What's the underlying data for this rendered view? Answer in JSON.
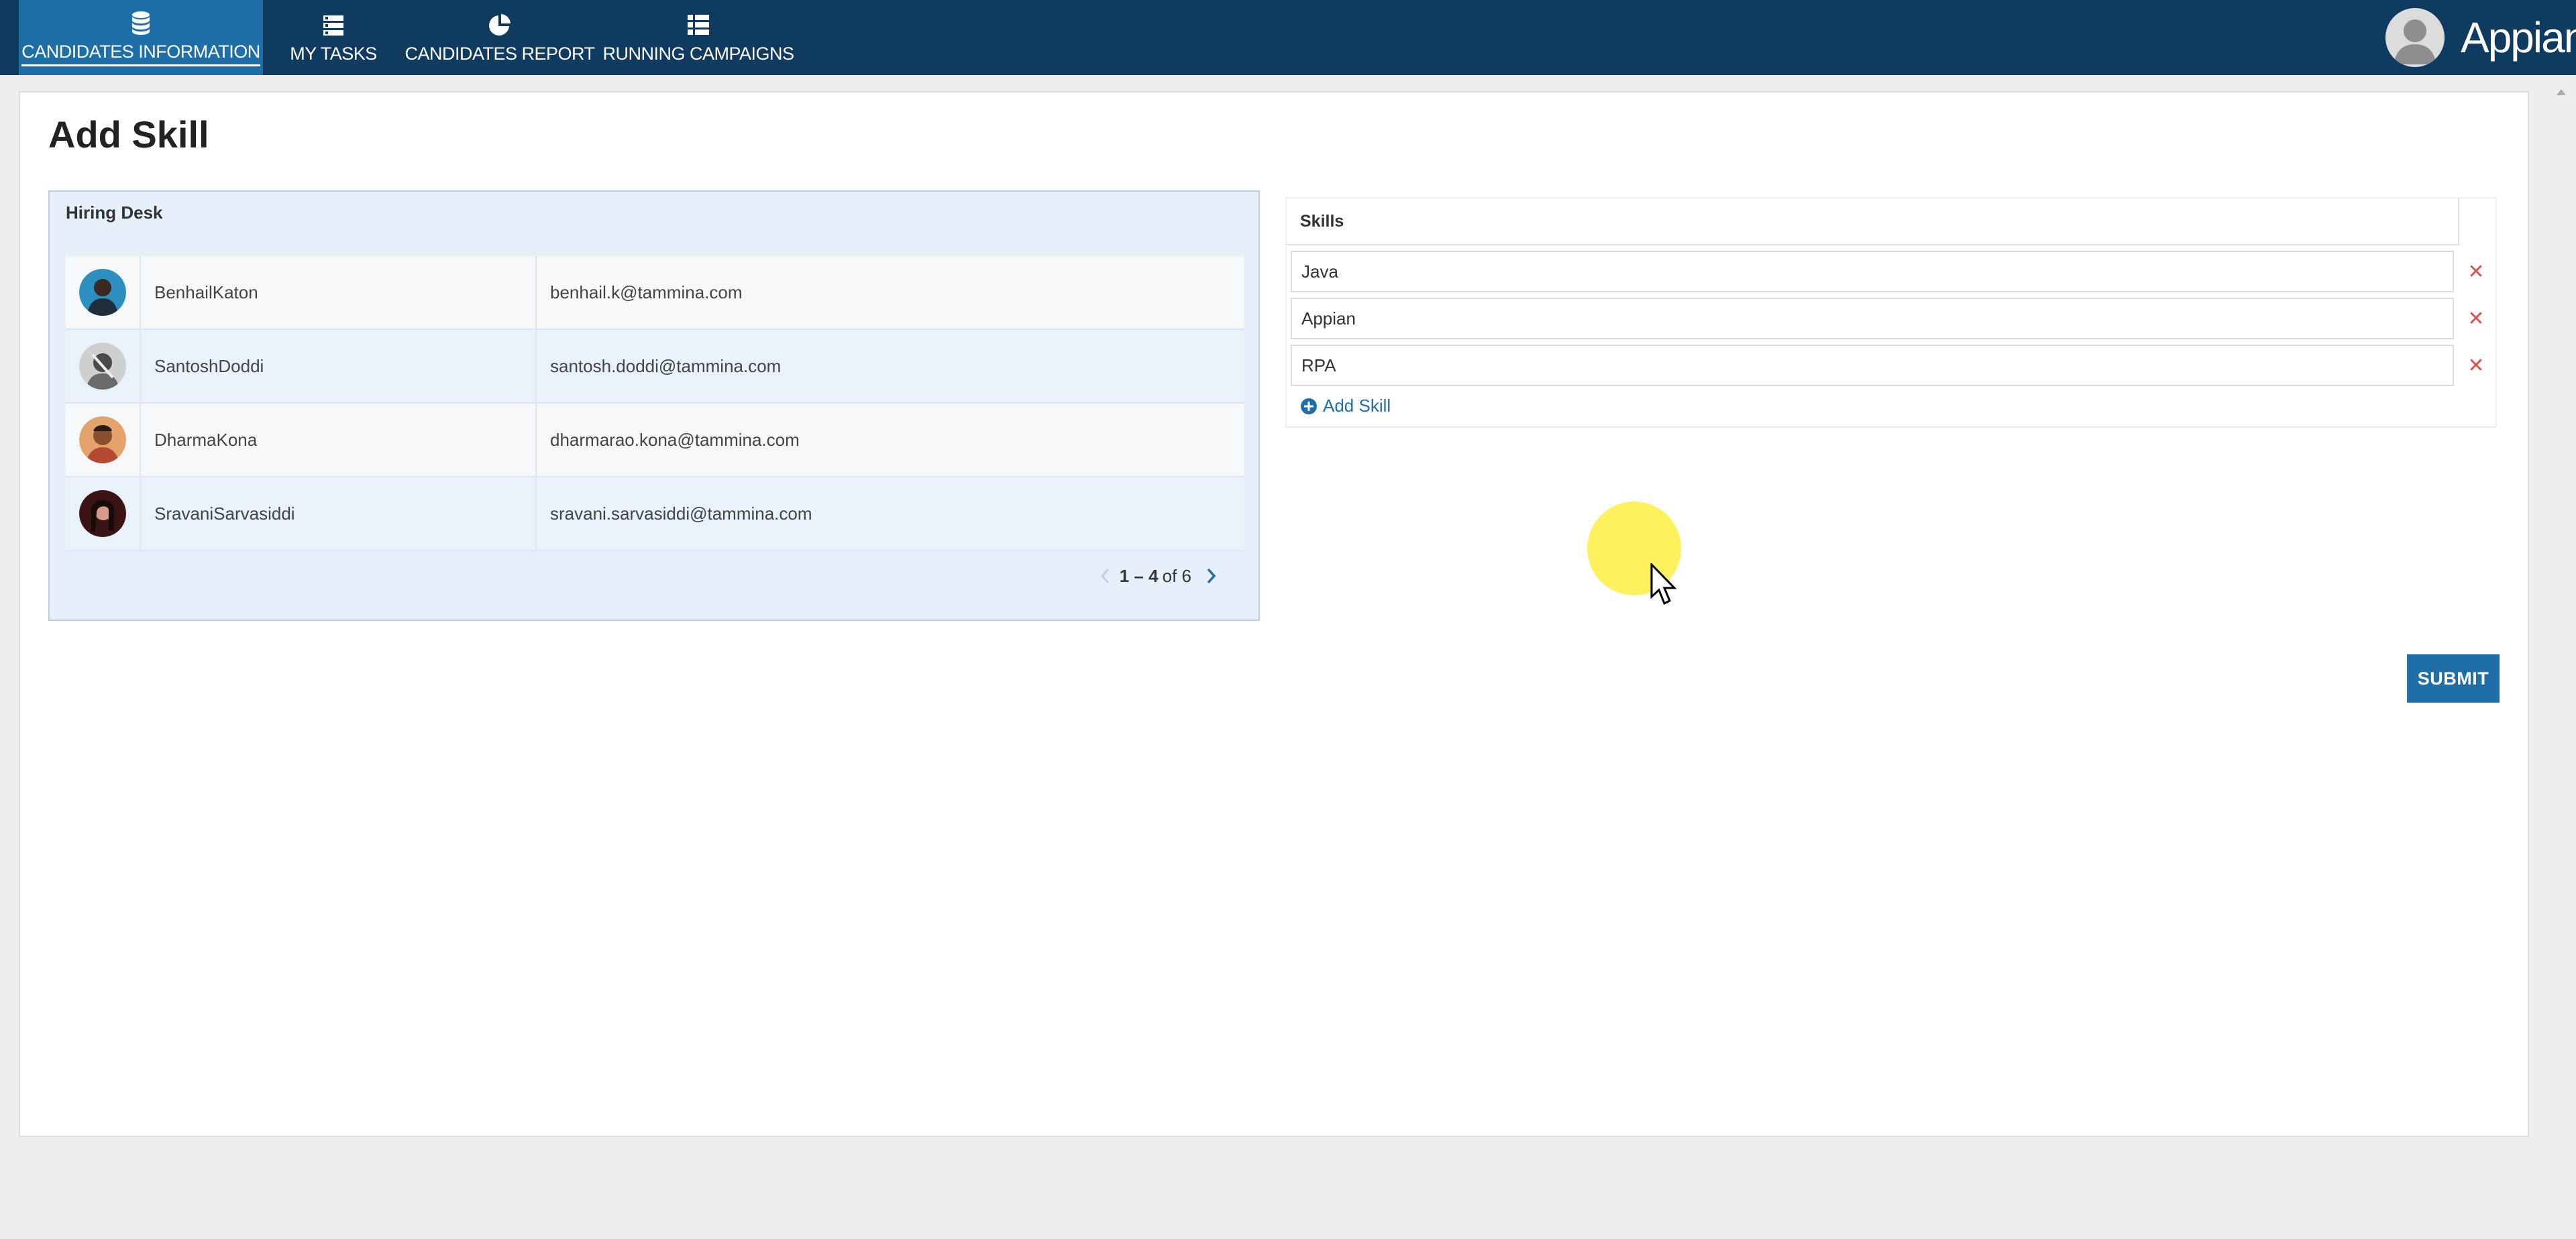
{
  "nav": {
    "tabs": [
      {
        "label": "CANDIDATES INFORMATION",
        "icon": "database-icon",
        "active": true
      },
      {
        "label": "MY TASKS",
        "icon": "tasks-icon",
        "active": false
      },
      {
        "label": "CANDIDATES REPORT",
        "icon": "pie-chart-icon",
        "active": false
      },
      {
        "label": "RUNNING CAMPAIGNS",
        "icon": "list-icon",
        "active": false
      }
    ],
    "logo": "Appian"
  },
  "page": {
    "title": "Add Skill"
  },
  "hiring_desk": {
    "label": "Hiring Desk",
    "rows": [
      {
        "name": "BenhailKaton",
        "email": "benhail.k@tammina.com"
      },
      {
        "name": "SantoshDoddi",
        "email": "santosh.doddi@tammina.com"
      },
      {
        "name": "DharmaKona",
        "email": "dharmarao.kona@tammina.com"
      },
      {
        "name": "SravaniSarvasiddi",
        "email": "sravani.sarvasiddi@tammina.com"
      }
    ],
    "pager": {
      "range": "1 – 4",
      "total": "of 6"
    }
  },
  "skills": {
    "label": "Skills",
    "items": [
      {
        "value": "Java"
      },
      {
        "value": "Appian"
      },
      {
        "value": "RPA"
      }
    ],
    "add_label": "Add Skill"
  },
  "actions": {
    "submit_label": "SUBMIT"
  },
  "colors": {
    "nav_bg": "#0e3b5f",
    "nav_active": "#1e6ea8",
    "primary": "#1e6ea8",
    "remove": "#d9534f"
  }
}
